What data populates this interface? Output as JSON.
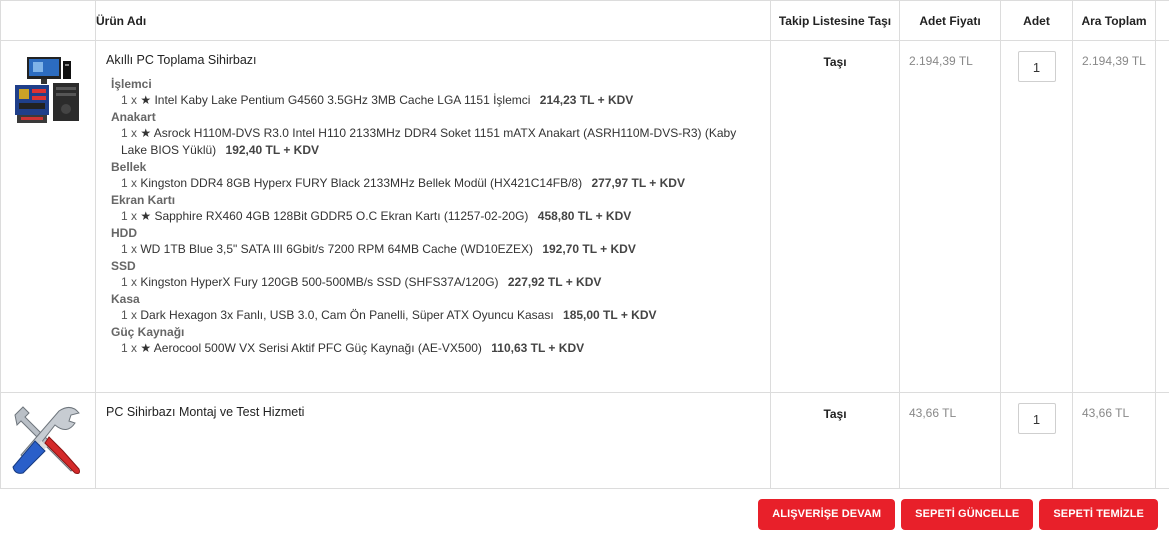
{
  "headers": {
    "name": "Ürün Adı",
    "wishlist": "Takip Listesine Taşı",
    "unit_price": "Adet Fiyatı",
    "qty": "Adet",
    "subtotal": "Ara Toplam"
  },
  "items": [
    {
      "title": "Akıllı PC Toplama Sihirbazı",
      "wishlist_label": "Taşı",
      "unit_price": "2.194,39 TL",
      "qty": "1",
      "subtotal": "2.194,39 TL",
      "components": [
        {
          "category": "İşlemci",
          "qty": "1 x",
          "name": "★ Intel Kaby Lake Pentium G4560 3.5GHz 3MB Cache LGA 1151 İşlemci",
          "price": "214,23 TL + KDV"
        },
        {
          "category": "Anakart",
          "qty": "1 x",
          "name": "★ Asrock H110M-DVS R3.0 Intel H110 2133MHz DDR4 Soket 1151 mATX Anakart (ASRH110M-DVS-R3) (Kaby Lake BIOS Yüklü)",
          "price": "192,40 TL + KDV"
        },
        {
          "category": "Bellek",
          "qty": "1 x",
          "name": "Kingston DDR4 8GB Hyperx FURY Black 2133MHz Bellek Modül (HX421C14FB/8)",
          "price": "277,97 TL + KDV"
        },
        {
          "category": "Ekran Kartı",
          "qty": "1 x",
          "name": "★ Sapphire RX460 4GB 128Bit GDDR5 O.C Ekran Kartı (11257-02-20G)",
          "price": "458,80 TL + KDV"
        },
        {
          "category": "HDD",
          "qty": "1 x",
          "name": "WD 1TB Blue 3,5\" SATA III 6Gbit/s 7200 RPM 64MB Cache (WD10EZEX)",
          "price": "192,70 TL + KDV"
        },
        {
          "category": "SSD",
          "qty": "1 x",
          "name": "Kingston HyperX Fury 120GB 500-500MB/s SSD (SHFS37A/120G)",
          "price": "227,92 TL + KDV"
        },
        {
          "category": "Kasa",
          "qty": "1 x",
          "name": "Dark Hexagon 3x Fanlı, USB 3.0, Cam Ön Panelli, Süper ATX Oyuncu Kasası",
          "price": "185,00 TL + KDV"
        },
        {
          "category": "Güç Kaynağı",
          "qty": "1 x",
          "name": "★ Aerocool 500W VX Serisi Aktif PFC Güç Kaynağı (AE-VX500)",
          "price": "110,63 TL + KDV"
        }
      ]
    },
    {
      "title": "PC Sihirbazı Montaj ve Test Hizmeti",
      "wishlist_label": "Taşı",
      "unit_price": "43,66 TL",
      "qty": "1",
      "subtotal": "43,66 TL"
    }
  ],
  "buttons": {
    "continue": "ALIŞVERİŞE DEVAM",
    "update": "SEPETİ GÜNCELLE",
    "clear": "SEPETİ TEMİZLE"
  },
  "colors": {
    "accent": "#e8202a",
    "border": "#dcdcdc"
  },
  "icons": {
    "delete": "trash-icon",
    "product1": "pc-components-image",
    "product2": "tools-image"
  }
}
